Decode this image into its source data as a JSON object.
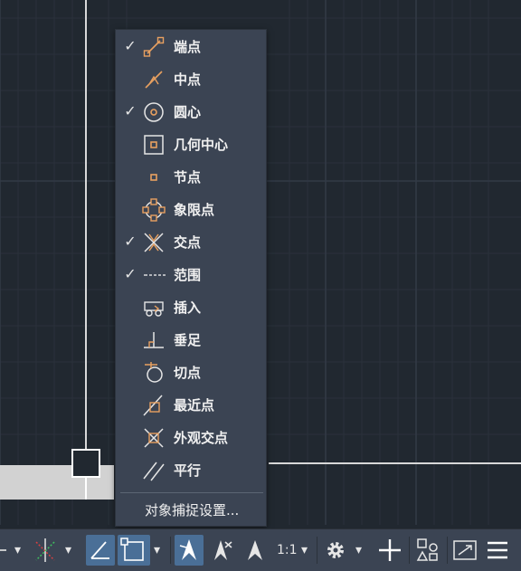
{
  "canvas": {
    "background": "#212830"
  },
  "snap_menu": {
    "items": [
      {
        "label": "端点",
        "checked": true,
        "icon": "endpoint-icon"
      },
      {
        "label": "中点",
        "checked": false,
        "icon": "midpoint-icon"
      },
      {
        "label": "圆心",
        "checked": true,
        "icon": "center-icon"
      },
      {
        "label": "几何中心",
        "checked": false,
        "icon": "geometric-center-icon"
      },
      {
        "label": "节点",
        "checked": false,
        "icon": "node-icon"
      },
      {
        "label": "象限点",
        "checked": false,
        "icon": "quadrant-icon"
      },
      {
        "label": "交点",
        "checked": true,
        "icon": "intersection-icon"
      },
      {
        "label": "范围",
        "checked": true,
        "icon": "extension-icon"
      },
      {
        "label": "插入",
        "checked": false,
        "icon": "insertion-icon"
      },
      {
        "label": "垂足",
        "checked": false,
        "icon": "perpendicular-icon"
      },
      {
        "label": "切点",
        "checked": false,
        "icon": "tangent-icon"
      },
      {
        "label": "最近点",
        "checked": false,
        "icon": "nearest-icon"
      },
      {
        "label": "外观交点",
        "checked": false,
        "icon": "apparent-intersection-icon"
      },
      {
        "label": "平行",
        "checked": false,
        "icon": "parallel-icon"
      }
    ],
    "check_glyph": "✓",
    "settings_label": "对象捕捉设置..."
  },
  "statusbar": {
    "scale_label": "1:1",
    "dropdown_glyph": "▾",
    "accent": "#4a6f97",
    "snap_color": "#e8a060"
  }
}
